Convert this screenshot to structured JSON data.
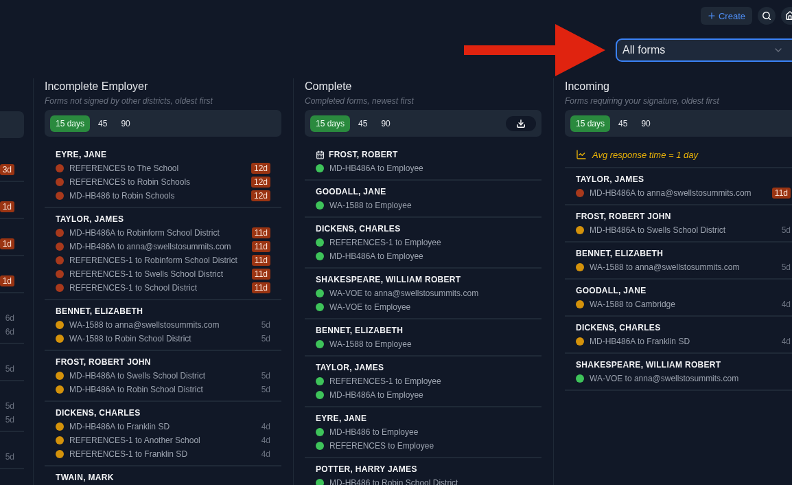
{
  "toolbar": {
    "create_label": "Create"
  },
  "form_filter": {
    "value": "All forms"
  },
  "columns": [
    {
      "kind": "partial",
      "groups": [
        {
          "items": [
            {
              "age": "3d",
              "flagged": true
            }
          ]
        },
        {
          "items": [
            {
              "age": "1d",
              "flagged": true
            }
          ]
        },
        {
          "items": [
            {
              "age": "1d",
              "flagged": true
            }
          ]
        },
        {
          "items": [
            {
              "age": "1d",
              "flagged": true
            }
          ]
        },
        {
          "items": [
            {
              "age": "6d",
              "flagged": false
            },
            {
              "age": "6d",
              "flagged": false
            }
          ]
        },
        {
          "items": [
            {
              "age": "5d",
              "flagged": false
            }
          ]
        },
        {
          "items": [
            {
              "age": "5d",
              "flagged": false
            },
            {
              "age": "5d",
              "flagged": false
            }
          ]
        },
        {
          "items": [
            {
              "age": "5d",
              "flagged": false
            }
          ]
        }
      ]
    },
    {
      "kind": "full",
      "title": "Incomplete Employer",
      "subtitle": "Forms not signed by other districts, oldest first",
      "download": false,
      "ranges": [
        {
          "label": "15 days",
          "selected": true
        },
        {
          "label": "45",
          "selected": false
        },
        {
          "label": "90",
          "selected": false
        }
      ],
      "groups": [
        {
          "name": "EYRE, JANE",
          "scheduled": false,
          "items": [
            {
              "form": "REFERENCES to The School",
              "color": "#a8391c",
              "age": "12d",
              "flagged": true
            },
            {
              "form": "REFERENCES to Robin Schools",
              "color": "#a8391c",
              "age": "12d",
              "flagged": true
            },
            {
              "form": "MD-HB486 to Robin Schools",
              "color": "#a8391c",
              "age": "12d",
              "flagged": true
            }
          ]
        },
        {
          "name": "TAYLOR, JAMES",
          "scheduled": false,
          "items": [
            {
              "form": "MD-HB486A to Robinform School District",
              "color": "#a8391c",
              "age": "11d",
              "flagged": true
            },
            {
              "form": "MD-HB486A to anna@swellstosummits.com",
              "color": "#a8391c",
              "age": "11d",
              "flagged": true
            },
            {
              "form": "REFERENCES-1 to Robinform School District",
              "color": "#a8391c",
              "age": "11d",
              "flagged": true
            },
            {
              "form": "REFERENCES-1 to Swells School District",
              "color": "#a8391c",
              "age": "11d",
              "flagged": true
            },
            {
              "form": "REFERENCES-1 to School District",
              "color": "#a8391c",
              "age": "11d",
              "flagged": true
            }
          ]
        },
        {
          "name": "BENNET, ELIZABETH",
          "scheduled": false,
          "items": [
            {
              "form": "WA-1588 to anna@swellstosummits.com",
              "color": "#d4920b",
              "age": "5d",
              "flagged": false
            },
            {
              "form": "WA-1588 to Robin School District",
              "color": "#d4920b",
              "age": "5d",
              "flagged": false
            }
          ]
        },
        {
          "name": "FROST, ROBERT JOHN",
          "scheduled": false,
          "items": [
            {
              "form": "MD-HB486A to Swells School District",
              "color": "#d4920b",
              "age": "5d",
              "flagged": false
            },
            {
              "form": "MD-HB486A to Robin School District",
              "color": "#d4920b",
              "age": "5d",
              "flagged": false
            }
          ]
        },
        {
          "name": "DICKENS, CHARLES",
          "scheduled": false,
          "items": [
            {
              "form": "MD-HB486A to Franklin SD",
              "color": "#d4920b",
              "age": "4d",
              "flagged": false
            },
            {
              "form": "REFERENCES-1 to Another School",
              "color": "#d4920b",
              "age": "4d",
              "flagged": false
            },
            {
              "form": "REFERENCES-1 to Franklin SD",
              "color": "#d4920b",
              "age": "4d",
              "flagged": false
            }
          ]
        },
        {
          "name": "TWAIN, MARK",
          "scheduled": false
        }
      ]
    },
    {
      "kind": "full",
      "title": "Complete",
      "subtitle": "Completed forms, newest first",
      "download": true,
      "ranges": [
        {
          "label": "15 days",
          "selected": true
        },
        {
          "label": "45",
          "selected": false
        },
        {
          "label": "90",
          "selected": false
        }
      ],
      "groups": [
        {
          "name": "FROST, ROBERT",
          "scheduled": true,
          "items": [
            {
              "form": "MD-HB486A to Employee",
              "color": "#3ec35a"
            }
          ]
        },
        {
          "name": "GOODALL, JANE",
          "scheduled": false,
          "items": [
            {
              "form": "WA-1588 to Employee",
              "color": "#3ec35a"
            }
          ]
        },
        {
          "name": "DICKENS, CHARLES",
          "scheduled": false,
          "items": [
            {
              "form": "REFERENCES-1 to Employee",
              "color": "#3ec35a"
            },
            {
              "form": "MD-HB486A to Employee",
              "color": "#3ec35a"
            }
          ]
        },
        {
          "name": "SHAKESPEARE, WILLIAM ROBERT",
          "scheduled": false,
          "items": [
            {
              "form": "WA-VOE to anna@swellstosummits.com",
              "color": "#3ec35a"
            },
            {
              "form": "WA-VOE to Employee",
              "color": "#3ec35a"
            }
          ]
        },
        {
          "name": "BENNET, ELIZABETH",
          "scheduled": false,
          "items": [
            {
              "form": "WA-1588 to Employee",
              "color": "#3ec35a"
            }
          ]
        },
        {
          "name": "TAYLOR, JAMES",
          "scheduled": false,
          "items": [
            {
              "form": "REFERENCES-1 to Employee",
              "color": "#3ec35a"
            },
            {
              "form": "MD-HB486A to Employee",
              "color": "#3ec35a"
            }
          ]
        },
        {
          "name": "EYRE, JANE",
          "scheduled": false,
          "items": [
            {
              "form": "MD-HB486 to Employee",
              "color": "#3ec35a"
            },
            {
              "form": "REFERENCES to Employee",
              "color": "#3ec35a"
            }
          ]
        },
        {
          "name": "POTTER, HARRY JAMES",
          "scheduled": false,
          "items": [
            {
              "form": "MD-HB486 to Robin School District",
              "color": "#3ec35a"
            }
          ]
        }
      ]
    },
    {
      "kind": "full",
      "title": "Incoming",
      "subtitle": "Forms requiring your signature, oldest first",
      "download": false,
      "note": "Avg response time = 1 day",
      "ranges": [
        {
          "label": "15 days",
          "selected": true
        },
        {
          "label": "45",
          "selected": false
        },
        {
          "label": "90",
          "selected": false
        }
      ],
      "groups": [
        {
          "name": "TAYLOR, JAMES",
          "scheduled": false,
          "items": [
            {
              "form": "MD-HB486A to anna@swellstosummits.com",
              "color": "#a8391c",
              "age": "11d",
              "flagged": true
            }
          ]
        },
        {
          "name": "FROST, ROBERT JOHN",
          "scheduled": false,
          "items": [
            {
              "form": "MD-HB486A to Swells School District",
              "color": "#d4920b",
              "age": "5d",
              "flagged": false
            }
          ]
        },
        {
          "name": "BENNET, ELIZABETH",
          "scheduled": false,
          "items": [
            {
              "form": "WA-1588 to anna@swellstosummits.com",
              "color": "#d4920b",
              "age": "5d",
              "flagged": false
            }
          ]
        },
        {
          "name": "GOODALL, JANE",
          "scheduled": false,
          "items": [
            {
              "form": "WA-1588 to Cambridge",
              "color": "#d4920b",
              "age": "4d",
              "flagged": false
            }
          ]
        },
        {
          "name": "DICKENS, CHARLES",
          "scheduled": false,
          "items": [
            {
              "form": "MD-HB486A to Franklin SD",
              "color": "#d4920b",
              "age": "4d",
              "flagged": false
            }
          ]
        },
        {
          "name": "SHAKESPEARE, WILLIAM ROBERT",
          "scheduled": false,
          "items": [
            {
              "form": "WA-VOE to anna@swellstosummits.com",
              "color": "#3ec35a"
            }
          ]
        }
      ]
    }
  ]
}
